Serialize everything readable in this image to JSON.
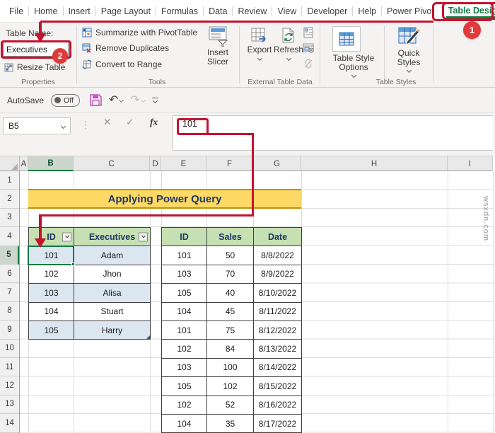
{
  "watermark": "wsxdn.com",
  "menu_bar": {
    "tabs": [
      "File",
      "Home",
      "Insert",
      "Page Layout",
      "Formulas",
      "Data",
      "Review",
      "View",
      "Developer",
      "Help",
      "Power Pivot"
    ],
    "active_tab": "Table Design"
  },
  "ribbon": {
    "properties_group": {
      "table_name_label": "Table Name:",
      "table_name_value": "Executives",
      "resize_table_label": "Resize Table",
      "group_label": "Properties"
    },
    "tools_group": {
      "summarize_label": "Summarize with PivotTable",
      "remove_duplicates_label": "Remove Duplicates",
      "convert_to_range_label": "Convert to Range",
      "insert_slicer_label": "Insert Slicer",
      "group_label": "Tools"
    },
    "external_group": {
      "export_label": "Export",
      "refresh_label": "Refresh",
      "group_label": "External Table Data"
    },
    "styles_group": {
      "table_style_options_label": "Table Style Options",
      "quick_styles_label": "Quick Styles",
      "group_label": "Table Styles"
    }
  },
  "quick_access": {
    "autosave_label": "AutoSave",
    "autosave_state": "Off"
  },
  "formula_bar": {
    "name_box_value": "B5",
    "fx_label": "fx",
    "formula_value": "101"
  },
  "annotations": {
    "badge_1": "1",
    "badge_2": "2"
  },
  "grid": {
    "column_headers": [
      "A",
      "B",
      "C",
      "D",
      "E",
      "F",
      "G",
      "H",
      "I"
    ],
    "row_headers": [
      "1",
      "2",
      "3",
      "4",
      "5",
      "6",
      "7",
      "8",
      "9",
      "10",
      "11",
      "12",
      "13",
      "14"
    ],
    "selected_cell": "B5",
    "selected_column": "B",
    "selected_row": "5"
  },
  "sheet": {
    "title_banner": "Applying Power Query",
    "executives_table": {
      "headers": [
        "ID",
        "Executives"
      ],
      "rows": [
        [
          "101",
          "Adam"
        ],
        [
          "102",
          "Jhon"
        ],
        [
          "103",
          "Alisa"
        ],
        [
          "104",
          "Stuart"
        ],
        [
          "105",
          "Harry"
        ]
      ]
    },
    "sales_table": {
      "headers": [
        "ID",
        "Sales",
        "Date"
      ],
      "rows": [
        [
          "101",
          "50",
          "8/8/2022"
        ],
        [
          "103",
          "70",
          "8/9/2022"
        ],
        [
          "105",
          "40",
          "8/10/2022"
        ],
        [
          "104",
          "45",
          "8/11/2022"
        ],
        [
          "101",
          "75",
          "8/12/2022"
        ],
        [
          "102",
          "84",
          "8/13/2022"
        ],
        [
          "103",
          "100",
          "8/14/2022"
        ],
        [
          "105",
          "102",
          "8/15/2022"
        ],
        [
          "102",
          "52",
          "8/16/2022"
        ],
        [
          "104",
          "35",
          "8/17/2022"
        ]
      ]
    }
  },
  "colors": {
    "annotation_red": "#c41230",
    "badge_red": "#e03a3a",
    "excel_green": "#107c41",
    "banner_yellow": "#ffd966",
    "banner_border": "#bf9000",
    "table_header_green": "#c6e0b4",
    "banded_row_blue": "#dce6f1",
    "header_text_navy": "#1f3864",
    "save_icon_magenta": "#c353bd"
  }
}
